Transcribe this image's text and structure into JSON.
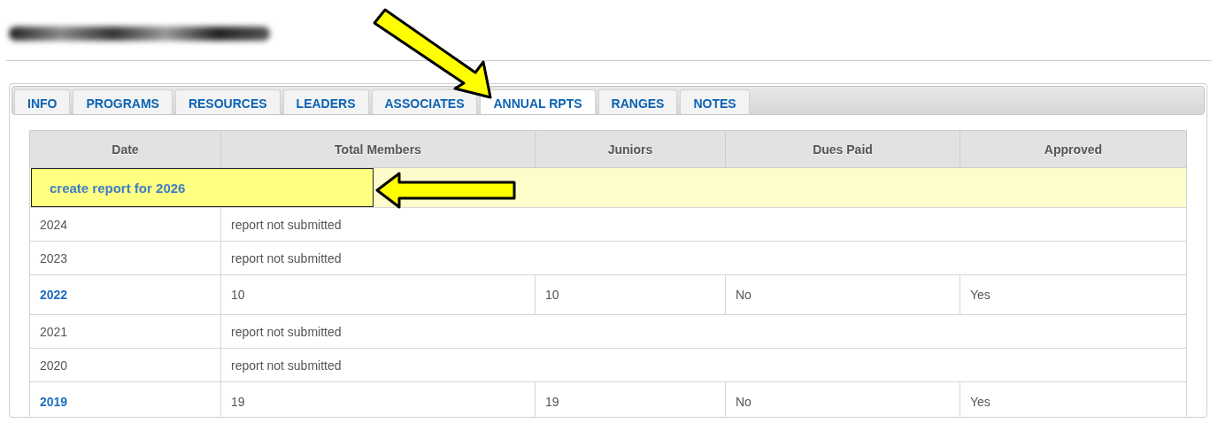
{
  "tabs": [
    {
      "label": "INFO",
      "selected": false
    },
    {
      "label": "PROGRAMS",
      "selected": false
    },
    {
      "label": "RESOURCES",
      "selected": false
    },
    {
      "label": "LEADERS",
      "selected": false
    },
    {
      "label": "ASSOCIATES",
      "selected": false
    },
    {
      "label": "ANNUAL RPTS",
      "selected": true
    },
    {
      "label": "RANGES",
      "selected": false
    },
    {
      "label": "NOTES",
      "selected": false
    }
  ],
  "table": {
    "columns": [
      "Date",
      "Total Members",
      "Juniors",
      "Dues Paid",
      "Approved"
    ],
    "rows": [
      {
        "kind": "create",
        "link": "create report for 2026"
      },
      {
        "kind": "missing",
        "date": "2024",
        "message": "report not submitted"
      },
      {
        "kind": "missing",
        "date": "2023",
        "message": "report not submitted"
      },
      {
        "kind": "report",
        "date": "2022",
        "total_members": "10",
        "juniors": "10",
        "dues_paid": "No",
        "approved": "Yes"
      },
      {
        "kind": "missing",
        "date": "2021",
        "message": "report not submitted"
      },
      {
        "kind": "missing",
        "date": "2020",
        "message": "report not submitted"
      },
      {
        "kind": "report",
        "date": "2019",
        "total_members": "19",
        "juniors": "19",
        "dues_paid": "No",
        "approved": "Yes"
      }
    ]
  }
}
